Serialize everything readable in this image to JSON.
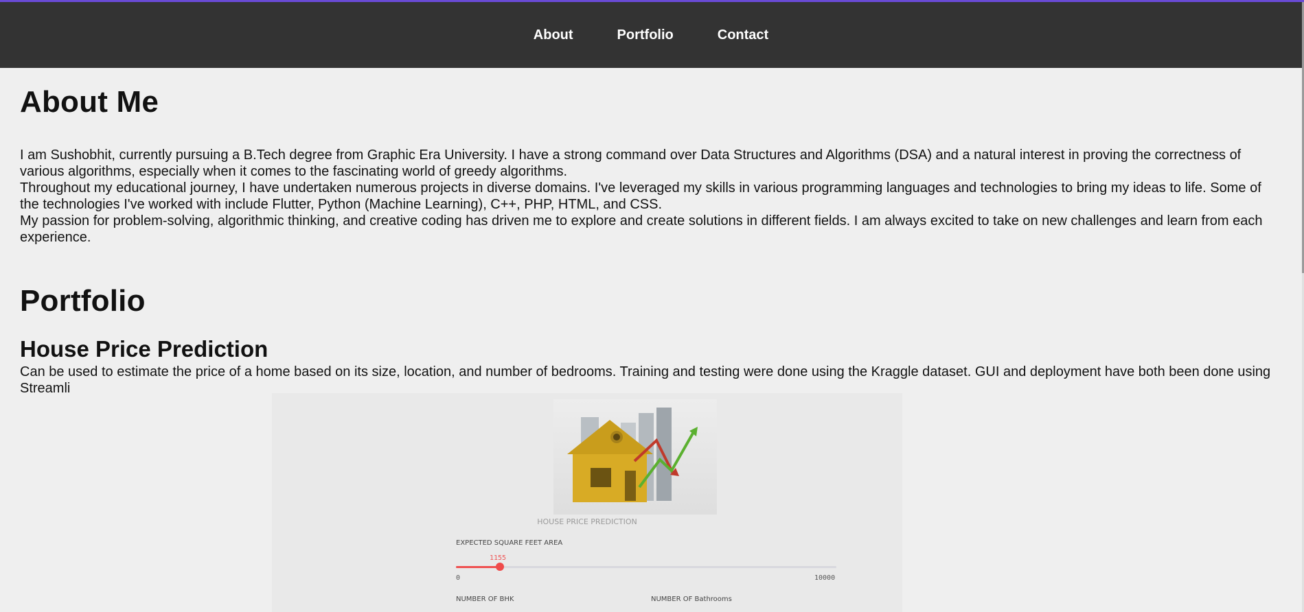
{
  "nav": {
    "items": [
      "About",
      "Portfolio",
      "Contact"
    ]
  },
  "about": {
    "title": "About Me",
    "paragraphs": [
      "I am Sushobhit, currently pursuing a B.Tech degree from Graphic Era University. I have a strong command over Data Structures and Algorithms (DSA) and a natural interest in proving the correctness of various algorithms, especially when it comes to the fascinating world of greedy algorithms.",
      "Throughout my educational journey, I have undertaken numerous projects in diverse domains. I've leveraged my skills in various programming languages and technologies to bring my ideas to life. Some of the technologies I've worked with include Flutter, Python (Machine Learning), C++, PHP, HTML, and CSS.",
      "My passion for problem-solving, algorithmic thinking, and creative coding has driven me to explore and create solutions in different fields. I am always excited to take on new challenges and learn from each experience."
    ]
  },
  "portfolio": {
    "title": "Portfolio",
    "project": {
      "title": "House Price Prediction",
      "description": "Can be used to estimate the price of a home based on its size, location, and number of bedrooms. Training and testing were done using the Kraggle dataset. GUI and deployment have both been done using Streamli",
      "screenshot": {
        "caption": "HOUSE PRICE PREDICTION",
        "sqft_label": "EXPECTED SQUARE FEET AREA",
        "sqft_value": "1155",
        "sqft_min": "0",
        "sqft_max": "10000",
        "bhk_label": "NUMBER OF BHK",
        "bath_label": "NUMBER OF Bathrooms"
      }
    }
  },
  "colors": {
    "accent_line": "#6a4bd6",
    "nav_bg": "#333333",
    "slider": "#ef4b4b"
  }
}
